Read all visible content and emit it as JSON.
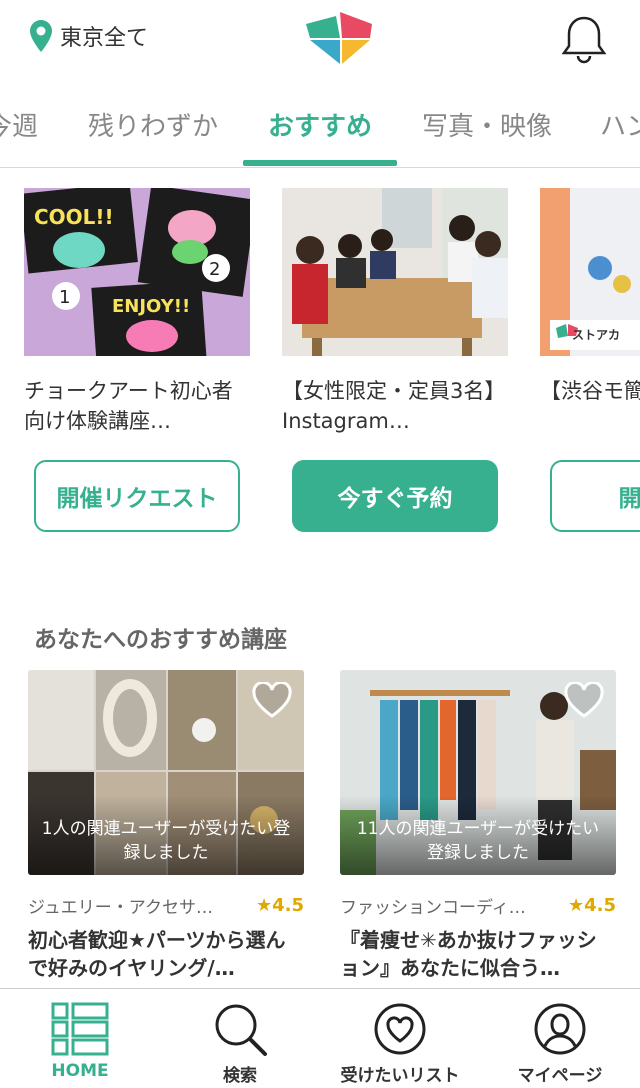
{
  "header": {
    "location": "東京全て",
    "icons": [
      "location-pin-icon",
      "app-logo",
      "bell-icon"
    ]
  },
  "tabs": [
    {
      "label": "今週",
      "active": false
    },
    {
      "label": "残りわずか",
      "active": false
    },
    {
      "label": "おすすめ",
      "active": true
    },
    {
      "label": "写真・映像",
      "active": false
    },
    {
      "label": "ハン",
      "active": false
    }
  ],
  "carousel": [
    {
      "title": "チョークアート初心者向け体験講座…",
      "button": "開催リクエスト",
      "button_style": "outline"
    },
    {
      "title": "【女性限定・定員3名】 Instagram…",
      "button": "今すぐ予約",
      "button_style": "filled"
    },
    {
      "title": "【渋谷モ簡単☆コ",
      "button": "開催リ",
      "button_style": "outline",
      "badge": "ストアカ"
    }
  ],
  "recommend": {
    "section_title": "あなたへのおすすめ講座",
    "items": [
      {
        "overlay": "1人の関連ユーザーが受けたい登録しました",
        "category": "ジュエリー・アクセサ…",
        "rating": "★4.5",
        "title": "初心者歓迎★パーツから選んで好みのイヤリング/…"
      },
      {
        "overlay": "11人の関連ユーザーが受けたい登録しました",
        "category": "ファッションコーディ…",
        "rating": "★4.5",
        "title": "『着痩せ✳あか抜けファッション』あなたに似合う…"
      }
    ]
  },
  "bottom_nav": [
    {
      "label": "HOME",
      "icon": "home-grid-icon",
      "active": true
    },
    {
      "label": "検索",
      "icon": "search-icon",
      "active": false
    },
    {
      "label": "受けたいリスト",
      "icon": "heart-icon",
      "active": false
    },
    {
      "label": "マイページ",
      "icon": "user-icon",
      "active": false
    }
  ],
  "colors": {
    "accent": "#36b08f",
    "rating": "#e0a800"
  }
}
